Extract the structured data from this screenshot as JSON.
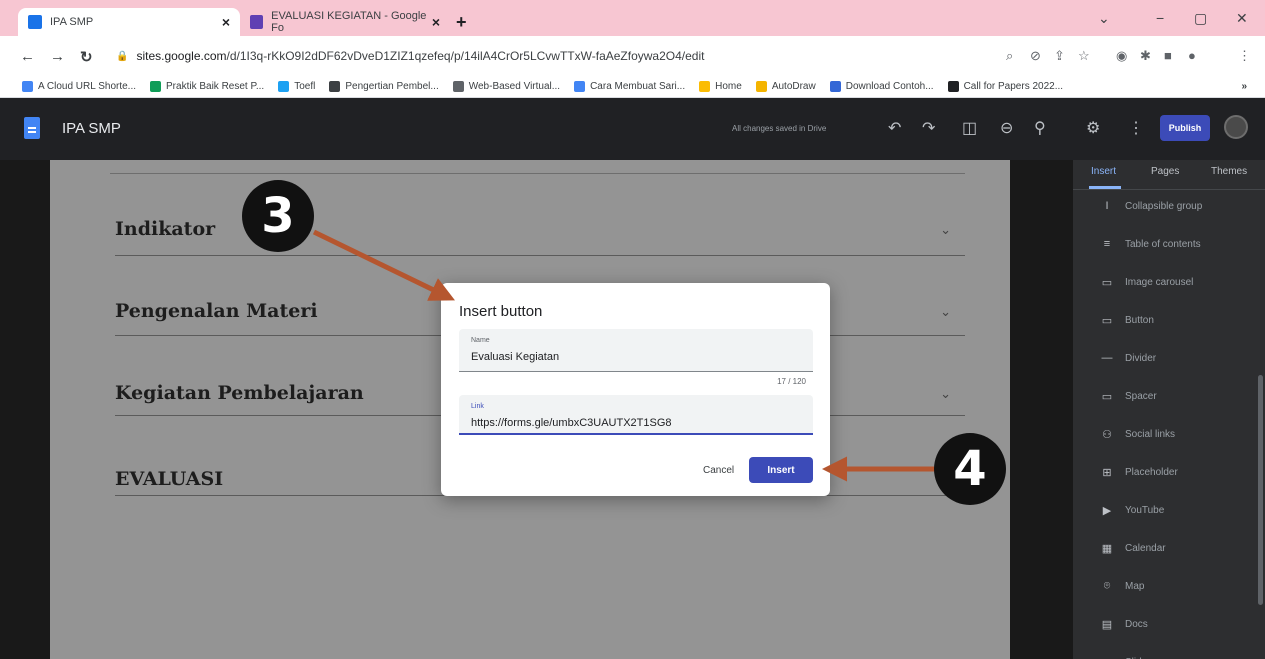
{
  "browser": {
    "tabs": [
      {
        "title": "IPA SMP",
        "close": "×"
      },
      {
        "title": "EVALUASI KEGIATAN - Google Fo",
        "close": "×"
      }
    ],
    "new_tab": "+",
    "window_controls": [
      "⌄",
      "−",
      "▢",
      "✕"
    ],
    "url_host": "sites.google.com",
    "url_path": "/d/1I3q-rKkO9I2dDF62vDveD1ZIZ1qzefeq/p/14ilA4CrOr5LCvwTTxW-faAeZfoywa2O4/edit",
    "bookmarks": [
      {
        "label": "A Cloud URL Shorte...",
        "color": "#4285f4"
      },
      {
        "label": "Praktik Baik Reset P...",
        "color": "#0f9d58"
      },
      {
        "label": "Toefl",
        "color": "#1da1f2"
      },
      {
        "label": "Pengertian Pembel...",
        "color": "#3c4043"
      },
      {
        "label": "Web-Based Virtual...",
        "color": "#5f6368"
      },
      {
        "label": "Cara Membuat Sari...",
        "color": "#4285f4"
      },
      {
        "label": "Home",
        "color": "#fbbc04"
      },
      {
        "label": "AutoDraw",
        "color": "#f4b400"
      },
      {
        "label": "Download Contoh...",
        "color": "#3367d6"
      },
      {
        "label": "Call for Papers 2022...",
        "color": "#202124"
      }
    ],
    "bookmarks_more": "»"
  },
  "app": {
    "title": "IPA SMP",
    "saved_status": "All changes saved in Drive",
    "publish_label": "Publish"
  },
  "page": {
    "sections": [
      {
        "title": "Indikator"
      },
      {
        "title": "Pengenalan Materi"
      },
      {
        "title": "Kegiatan Pembelajaran"
      },
      {
        "title": "EVALUASI"
      }
    ]
  },
  "side_panel": {
    "tabs": [
      "Insert",
      "Pages",
      "Themes"
    ],
    "items": [
      {
        "label": "Collapsible group",
        "icon": "collapsible-group-icon",
        "glyph": "I"
      },
      {
        "label": "Table of contents",
        "icon": "table-of-contents-icon",
        "glyph": "≡"
      },
      {
        "label": "Image carousel",
        "icon": "image-carousel-icon",
        "glyph": "▭"
      },
      {
        "label": "Button",
        "icon": "button-icon",
        "glyph": "▭"
      },
      {
        "label": "Divider",
        "icon": "divider-icon",
        "glyph": "—"
      },
      {
        "label": "Spacer",
        "icon": "spacer-icon",
        "glyph": "▭"
      },
      {
        "label": "Social links",
        "icon": "social-links-icon",
        "glyph": "⚇"
      },
      {
        "label": "Placeholder",
        "icon": "placeholder-icon",
        "glyph": "⊞"
      },
      {
        "label": "YouTube",
        "icon": "youtube-icon",
        "glyph": "▶"
      },
      {
        "label": "Calendar",
        "icon": "calendar-icon",
        "glyph": "▦"
      },
      {
        "label": "Map",
        "icon": "map-pin-icon",
        "glyph": "⌾"
      },
      {
        "label": "Docs",
        "icon": "docs-icon",
        "glyph": "▤"
      },
      {
        "label": "Slides",
        "icon": "slides-icon",
        "glyph": "▭"
      }
    ]
  },
  "dialog": {
    "title": "Insert button",
    "name_label": "Name",
    "name_value": "Evaluasi Kegiatan",
    "char_counter": "17 / 120",
    "link_label": "Link",
    "link_value": "https://forms.gle/umbxC3UAUTX2T1SG8",
    "cancel_label": "Cancel",
    "insert_label": "Insert"
  },
  "annotations": {
    "step_3": "3",
    "step_4": "4",
    "arrow_color": "#b5562f"
  }
}
